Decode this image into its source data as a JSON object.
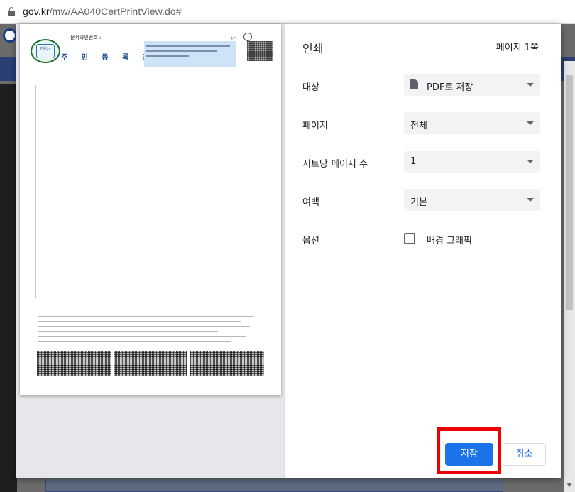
{
  "browser": {
    "url_host": "gov.kr",
    "url_path": "/mw/AA040CertPrintView.do#"
  },
  "preview": {
    "doc_label": "문서확인번호 :",
    "doc_title": "주 민 등 록 표",
    "seal_text": "민원24",
    "page_indicator": "1/1"
  },
  "print_dialog": {
    "title": "인쇄",
    "page_count": "페이지 1쪽",
    "destination": {
      "label": "대상",
      "value": "PDF로 저장"
    },
    "pages": {
      "label": "페이지",
      "value": "전체"
    },
    "pages_per_sheet": {
      "label": "시트당 페이지 수",
      "value": "1"
    },
    "margins": {
      "label": "여백",
      "value": "기본"
    },
    "options": {
      "label": "옵션",
      "background_graphics": "배경 그래픽",
      "background_graphics_checked": false
    },
    "save_button": "저장",
    "cancel_button": "취소"
  },
  "colors": {
    "primary": "#1a73e8",
    "highlight": "#ee0000"
  }
}
